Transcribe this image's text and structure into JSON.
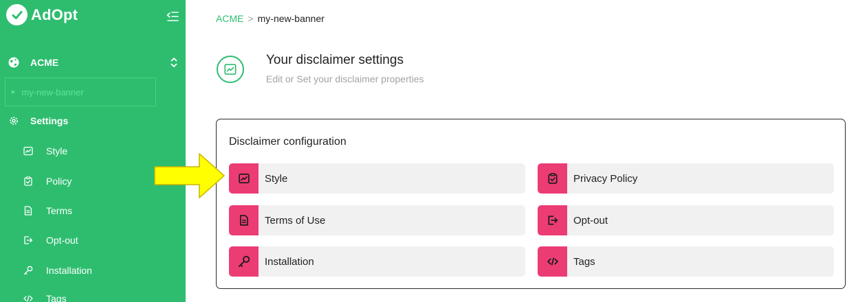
{
  "app": {
    "logo_text": "AdOpt"
  },
  "sidebar": {
    "org": {
      "label": "ACME"
    },
    "banner": {
      "label": "my-new-banner"
    },
    "settings": {
      "label": "Settings"
    },
    "items": [
      {
        "label": "Style",
        "icon": "style-icon"
      },
      {
        "label": "Policy",
        "icon": "policy-icon"
      },
      {
        "label": "Terms",
        "icon": "terms-icon"
      },
      {
        "label": "Opt-out",
        "icon": "opt-out-icon"
      },
      {
        "label": "Installation",
        "icon": "key-icon"
      },
      {
        "label": "Tags",
        "icon": "code-icon"
      }
    ]
  },
  "breadcrumb": {
    "root": "ACME",
    "separator": ">",
    "current": "my-new-banner"
  },
  "header": {
    "title": "Your disclaimer settings",
    "subtitle": "Edit or Set your disclaimer properties"
  },
  "config": {
    "title": "Disclaimer configuration",
    "tiles": [
      {
        "label": "Style",
        "icon": "style-icon"
      },
      {
        "label": "Privacy Policy",
        "icon": "clipboard-check-icon"
      },
      {
        "label": "Terms of Use",
        "icon": "document-icon"
      },
      {
        "label": "Opt-out",
        "icon": "opt-out-icon"
      },
      {
        "label": "Installation",
        "icon": "key-icon"
      },
      {
        "label": "Tags",
        "icon": "code-icon"
      }
    ]
  },
  "colors": {
    "brand_green": "#2ebd6f",
    "accent_pink": "#ec3c74",
    "tile_bg": "#f1f1f1",
    "arrow_yellow": "#ffff00"
  }
}
